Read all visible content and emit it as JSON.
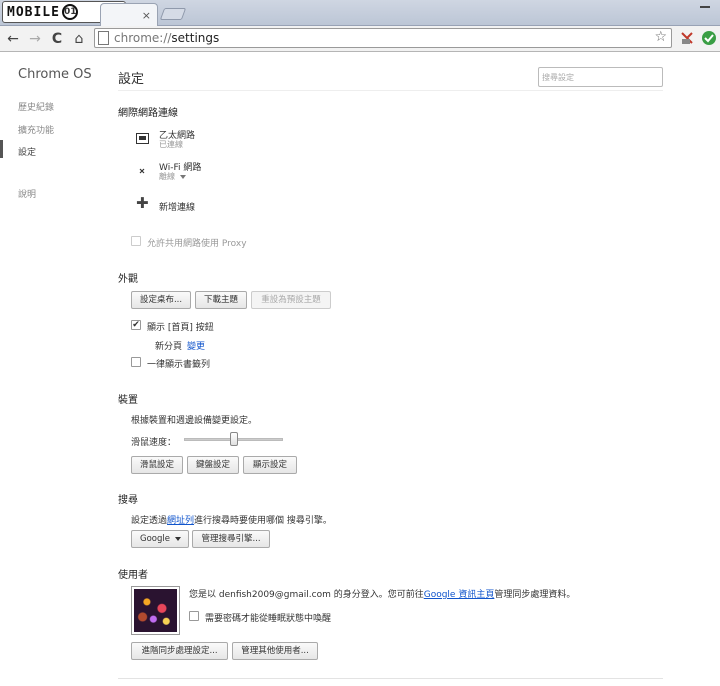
{
  "tabstrip": {
    "logo_text": "MOBILE",
    "logo_badge": "01",
    "tab_close": "×"
  },
  "toolbar": {
    "back": "←",
    "forward": "→",
    "reload": "C",
    "home": "⌂",
    "url_scheme": "chrome://",
    "url_path": "settings",
    "star": "☆"
  },
  "sidebar": {
    "brand": "Chrome OS",
    "items": [
      {
        "label": "歷史紀錄"
      },
      {
        "label": "擴充功能"
      },
      {
        "label": "設定"
      },
      {
        "label": "說明"
      }
    ]
  },
  "header": {
    "title": "設定",
    "search_placeholder": "搜尋設定"
  },
  "network": {
    "heading": "網際網路連線",
    "ethernet": {
      "name": "乙太網路",
      "status": "已連線"
    },
    "wifi": {
      "name": "Wi-Fi 網路",
      "status": "離線"
    },
    "add_connection": "新增連線",
    "proxy_label": "允許共用網路使用 Proxy"
  },
  "appearance": {
    "heading": "外觀",
    "set_wallpaper": "設定桌布...",
    "get_themes": "下載主題",
    "reset_theme": "重設為預設主題",
    "show_home": "顯示 [首頁] 按鈕",
    "new_tab": "新分頁",
    "change": "變更",
    "always_bookmarks": "一律顯示書籤列"
  },
  "device": {
    "heading": "裝置",
    "description": "根據裝置和週邊設備變更設定。",
    "touchpad_speed": "滑鼠速度：",
    "touchpad_speed_value": 0.5,
    "mouse_settings": "滑鼠設定",
    "keyboard_settings": "鍵盤設定",
    "display_settings": "顯示設定"
  },
  "search": {
    "heading": "搜尋",
    "desc_before": "設定透過",
    "desc_link": "網址列",
    "desc_after": "進行搜尋時要使用哪個 搜尋引擎。",
    "engine": "Google",
    "manage": "管理搜尋引擎..."
  },
  "users": {
    "heading": "使用者",
    "signed_in_prefix": "您是以 denfish2009@gmail.com 的身分登入。您可前往",
    "dashboard_link": "Google 資訊主頁",
    "signed_in_suffix": "管理同步處理資料。",
    "require_password": "需要密碼才能從睡眠狀態中喚醒",
    "advanced_sync": "進階同步處理設定...",
    "manage_users": "管理其他使用者..."
  },
  "colors": {
    "link": "#1155cc",
    "sidebar_text": "#888888"
  }
}
